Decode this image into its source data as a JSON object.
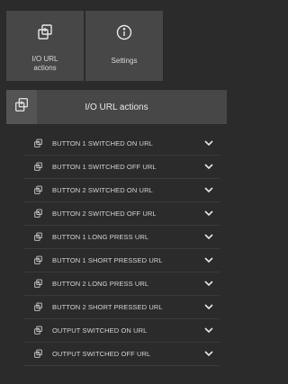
{
  "tiles": [
    {
      "label": "I/O URL\nactions",
      "icon": "io-url-actions-icon"
    },
    {
      "label": "Settings",
      "icon": "info-settings-icon"
    }
  ],
  "section": {
    "title": "I/O URL actions",
    "icon": "io-url-actions-icon"
  },
  "items": [
    {
      "label": "BUTTON 1 SWITCHED ON URL"
    },
    {
      "label": "BUTTON 1 SWITCHED OFF URL"
    },
    {
      "label": "BUTTON 2 SWITCHED ON URL"
    },
    {
      "label": "BUTTON 2 SWITCHED OFF URL"
    },
    {
      "label": "BUTTON 1 LONG PRESS URL"
    },
    {
      "label": "BUTTON 1 SHORT PRESSED URL"
    },
    {
      "label": "BUTTON 2 LONG PRESS URL"
    },
    {
      "label": "BUTTON 2 SHORT PRESSED URL"
    },
    {
      "label": "OUTPUT SWITCHED ON URL"
    },
    {
      "label": "OUTPUT SWITCHED OFF URL"
    }
  ],
  "colors": {
    "background": "#2b2b2b",
    "tile": "#474747",
    "text": "#e6e6e6"
  }
}
